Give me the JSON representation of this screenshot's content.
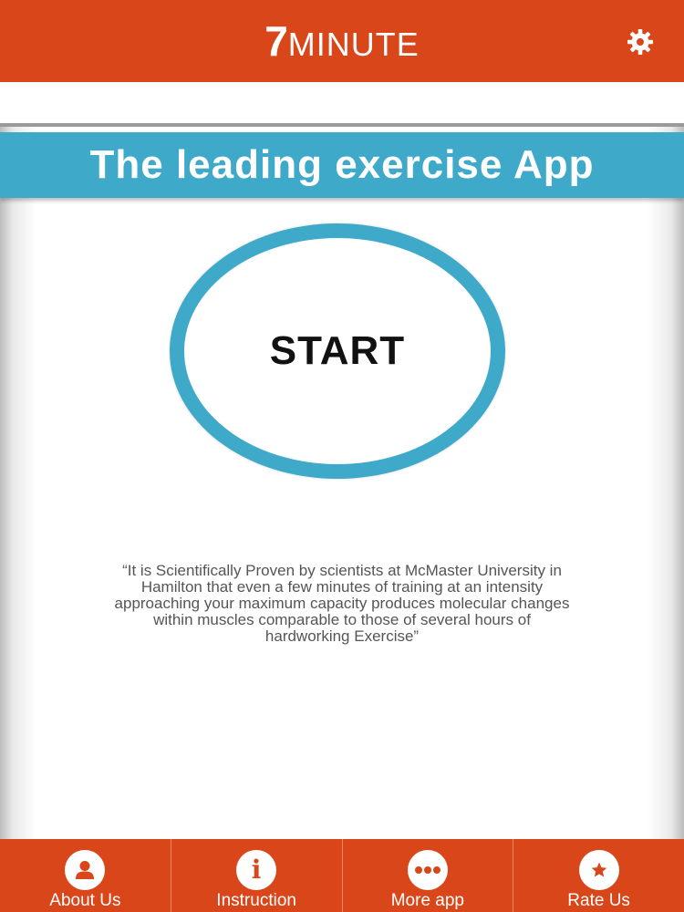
{
  "colors": {
    "accent": "#d9461a",
    "banner": "#3fa9c9",
    "ring": "#3fa9c9"
  },
  "header": {
    "title_number": "7",
    "title_word": "MINUTE",
    "settings_icon": "gear-icon"
  },
  "banner": {
    "text": "The leading exercise App"
  },
  "start": {
    "label": "START"
  },
  "quote": {
    "text": "“It is Scientifically Proven by scientists at McMaster University in Hamilton that even a few minutes of training at an intensity approaching your maximum capacity produces molecular changes within muscles comparable to those of several hours of hardworking Exercise”"
  },
  "tabs": [
    {
      "label": "About Us",
      "icon": "user-icon"
    },
    {
      "label": "Instruction",
      "icon": "info-icon"
    },
    {
      "label": "More app",
      "icon": "more-dots-icon"
    },
    {
      "label": "Rate Us",
      "icon": "star-icon"
    }
  ]
}
